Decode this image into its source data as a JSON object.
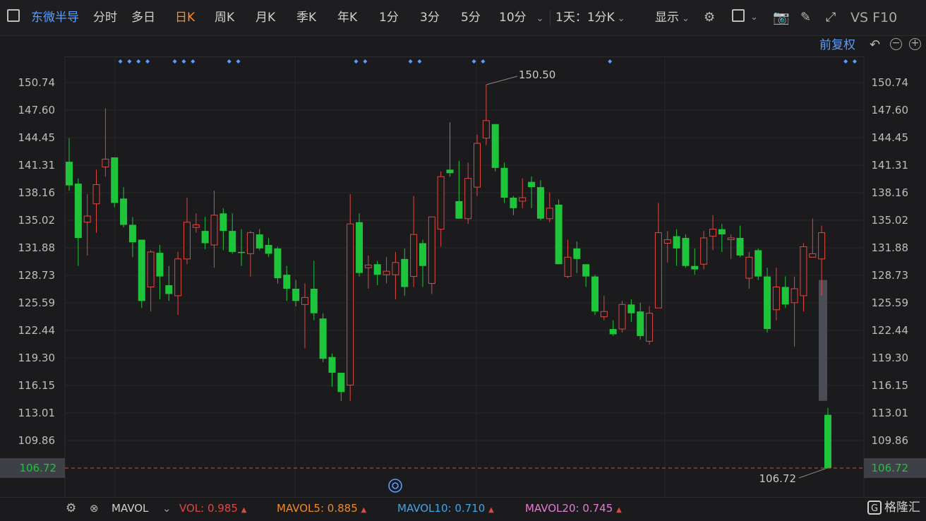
{
  "toolbar": {
    "stock_name": "东微半导",
    "periods": [
      "分时",
      "多日",
      "日K",
      "周K",
      "月K",
      "季K",
      "年K",
      "1分",
      "3分",
      "5分",
      "10分"
    ],
    "active_period": "日K",
    "multi": "1天：1分K",
    "display": "显示",
    "f10": "VS F10"
  },
  "chart_header": {
    "adjust": "前复权"
  },
  "axis": {
    "ticks": [
      "150.74",
      "147.60",
      "144.45",
      "141.31",
      "138.16",
      "135.02",
      "131.88",
      "128.73",
      "125.59",
      "122.44",
      "119.30",
      "116.15",
      "113.01",
      "109.86",
      "106.72"
    ],
    "current": "106.72",
    "high_label": "150.50",
    "low_label": "106.72"
  },
  "indicators": {
    "name": "MAVOL",
    "vol_label": "VOL:",
    "vol_value": "0.985",
    "mavol5_label": "MAVOL5:",
    "mavol5_value": "0.885",
    "mavol10_label": "MAVOL10:",
    "mavol10_value": "0.710",
    "mavol20_label": "MAVOL20:",
    "mavol20_value": "0.745",
    "arrow": "▲"
  },
  "brand": {
    "logo_mark": "G",
    "name": "格隆汇"
  },
  "colors": {
    "up": "#e2473f",
    "down": "#1ec53a",
    "accent": "#5b9cff",
    "active": "#ff8a1f",
    "gap": "#4a4d55"
  },
  "chart_data": {
    "type": "candlestick",
    "ylim": [
      106.72,
      150.74
    ],
    "candles": [
      {
        "o": 141.7,
        "c": 139.0,
        "h": 144.4,
        "l": 138.4
      },
      {
        "o": 139.2,
        "c": 133.0,
        "h": 139.8,
        "l": 129.8
      },
      {
        "o": 134.8,
        "c": 135.5,
        "h": 138.0,
        "l": 131.0
      },
      {
        "o": 136.9,
        "c": 139.1,
        "h": 140.8,
        "l": 133.6
      },
      {
        "o": 141.1,
        "c": 142.0,
        "h": 147.8,
        "l": 140.0
      },
      {
        "o": 142.2,
        "c": 137.0,
        "h": 142.2,
        "l": 136.5
      },
      {
        "o": 137.5,
        "c": 134.5,
        "h": 138.8,
        "l": 134.2
      },
      {
        "o": 134.5,
        "c": 132.5,
        "h": 135.4,
        "l": 130.8
      },
      {
        "o": 132.8,
        "c": 125.8,
        "h": 132.8,
        "l": 125.0
      },
      {
        "o": 127.4,
        "c": 131.4,
        "h": 131.6,
        "l": 124.6
      },
      {
        "o": 131.3,
        "c": 128.6,
        "h": 132.2,
        "l": 126.0
      },
      {
        "o": 127.6,
        "c": 126.6,
        "h": 129.8,
        "l": 125.8
      },
      {
        "o": 126.4,
        "c": 130.6,
        "h": 131.4,
        "l": 124.2
      },
      {
        "o": 130.6,
        "c": 134.8,
        "h": 137.6,
        "l": 130.0
      },
      {
        "o": 134.2,
        "c": 134.5,
        "h": 135.8,
        "l": 133.6
      },
      {
        "o": 133.8,
        "c": 132.4,
        "h": 135.4,
        "l": 131.7
      },
      {
        "o": 132.2,
        "c": 135.6,
        "h": 138.4,
        "l": 129.6
      },
      {
        "o": 135.8,
        "c": 133.8,
        "h": 136.4,
        "l": 131.6
      },
      {
        "o": 133.8,
        "c": 131.4,
        "h": 135.8,
        "l": 131.2
      },
      {
        "o": 131.4,
        "c": 131.3,
        "h": 134.0,
        "l": 129.8
      },
      {
        "o": 131.2,
        "c": 133.6,
        "h": 133.8,
        "l": 128.6
      },
      {
        "o": 133.4,
        "c": 131.8,
        "h": 134.0,
        "l": 131.6
      },
      {
        "o": 132.2,
        "c": 131.2,
        "h": 133.0,
        "l": 130.8
      },
      {
        "o": 131.8,
        "c": 128.4,
        "h": 132.0,
        "l": 127.8
      },
      {
        "o": 128.8,
        "c": 127.2,
        "h": 129.8,
        "l": 125.8
      },
      {
        "o": 127.2,
        "c": 125.8,
        "h": 128.2,
        "l": 125.2
      },
      {
        "o": 125.4,
        "c": 126.2,
        "h": 127.8,
        "l": 120.4
      },
      {
        "o": 127.2,
        "c": 124.4,
        "h": 130.4,
        "l": 123.6
      },
      {
        "o": 123.8,
        "c": 119.2,
        "h": 124.4,
        "l": 118.8
      },
      {
        "o": 119.4,
        "c": 117.6,
        "h": 119.8,
        "l": 116.0
      },
      {
        "o": 117.6,
        "c": 115.4,
        "h": 117.6,
        "l": 114.4
      },
      {
        "o": 116.2,
        "c": 134.6,
        "h": 138.0,
        "l": 114.4
      },
      {
        "o": 134.8,
        "c": 129.0,
        "h": 135.8,
        "l": 128.6
      },
      {
        "o": 129.6,
        "c": 129.9,
        "h": 131.0,
        "l": 127.2
      },
      {
        "o": 130.0,
        "c": 128.8,
        "h": 130.4,
        "l": 127.6
      },
      {
        "o": 128.8,
        "c": 129.2,
        "h": 130.8,
        "l": 127.8
      },
      {
        "o": 128.8,
        "c": 130.2,
        "h": 131.4,
        "l": 126.0
      },
      {
        "o": 130.6,
        "c": 127.4,
        "h": 131.8,
        "l": 126.4
      },
      {
        "o": 128.6,
        "c": 133.4,
        "h": 137.8,
        "l": 127.4
      },
      {
        "o": 132.4,
        "c": 129.8,
        "h": 132.8,
        "l": 127.4
      },
      {
        "o": 127.8,
        "c": 135.4,
        "h": 135.4,
        "l": 126.6
      },
      {
        "o": 134.0,
        "c": 140.0,
        "h": 140.6,
        "l": 132.0
      },
      {
        "o": 140.8,
        "c": 140.4,
        "h": 146.2,
        "l": 140.0
      },
      {
        "o": 137.2,
        "c": 135.2,
        "h": 141.8,
        "l": 135.2
      },
      {
        "o": 135.2,
        "c": 139.8,
        "h": 141.6,
        "l": 134.6
      },
      {
        "o": 138.8,
        "c": 143.8,
        "h": 144.8,
        "l": 137.8
      },
      {
        "o": 144.4,
        "c": 146.4,
        "h": 150.5,
        "l": 143.6
      },
      {
        "o": 146.0,
        "c": 141.0,
        "h": 146.0,
        "l": 140.6
      },
      {
        "o": 141.0,
        "c": 137.6,
        "h": 141.6,
        "l": 137.0
      },
      {
        "o": 137.6,
        "c": 136.4,
        "h": 137.8,
        "l": 135.6
      },
      {
        "o": 137.2,
        "c": 137.6,
        "h": 139.8,
        "l": 136.4
      },
      {
        "o": 139.4,
        "c": 138.8,
        "h": 140.0,
        "l": 136.4
      },
      {
        "o": 138.8,
        "c": 135.2,
        "h": 139.6,
        "l": 135.0
      },
      {
        "o": 135.2,
        "c": 136.4,
        "h": 138.2,
        "l": 134.8
      },
      {
        "o": 136.8,
        "c": 130.0,
        "h": 137.4,
        "l": 130.0
      },
      {
        "o": 128.6,
        "c": 130.8,
        "h": 132.8,
        "l": 128.4
      },
      {
        "o": 131.8,
        "c": 130.6,
        "h": 132.6,
        "l": 129.0
      },
      {
        "o": 130.0,
        "c": 128.6,
        "h": 130.0,
        "l": 127.4
      },
      {
        "o": 128.6,
        "c": 124.6,
        "h": 128.8,
        "l": 124.2
      },
      {
        "o": 124.0,
        "c": 124.6,
        "h": 126.4,
        "l": 123.6
      },
      {
        "o": 122.6,
        "c": 122.0,
        "h": 123.6,
        "l": 121.8
      },
      {
        "o": 122.6,
        "c": 125.4,
        "h": 125.8,
        "l": 122.2
      },
      {
        "o": 125.4,
        "c": 124.4,
        "h": 126.0,
        "l": 123.4
      },
      {
        "o": 124.6,
        "c": 121.8,
        "h": 125.6,
        "l": 121.4
      },
      {
        "o": 121.2,
        "c": 124.4,
        "h": 125.2,
        "l": 120.8
      },
      {
        "o": 125.0,
        "c": 133.6,
        "h": 137.0,
        "l": 125.0
      },
      {
        "o": 132.4,
        "c": 132.8,
        "h": 133.8,
        "l": 130.2
      },
      {
        "o": 133.2,
        "c": 131.8,
        "h": 134.0,
        "l": 129.8
      },
      {
        "o": 133.0,
        "c": 129.8,
        "h": 133.4,
        "l": 129.6
      },
      {
        "o": 129.8,
        "c": 129.4,
        "h": 131.8,
        "l": 128.8
      },
      {
        "o": 130.0,
        "c": 133.0,
        "h": 133.8,
        "l": 129.4
      },
      {
        "o": 133.2,
        "c": 134.0,
        "h": 135.6,
        "l": 131.6
      },
      {
        "o": 134.0,
        "c": 133.4,
        "h": 134.6,
        "l": 131.4
      },
      {
        "o": 132.8,
        "c": 133.0,
        "h": 133.4,
        "l": 130.6
      },
      {
        "o": 133.0,
        "c": 131.0,
        "h": 134.4,
        "l": 130.8
      },
      {
        "o": 128.4,
        "c": 130.8,
        "h": 131.4,
        "l": 127.2
      },
      {
        "o": 131.6,
        "c": 128.6,
        "h": 131.8,
        "l": 128.2
      },
      {
        "o": 128.6,
        "c": 122.6,
        "h": 129.6,
        "l": 122.2
      },
      {
        "o": 124.8,
        "c": 127.4,
        "h": 129.6,
        "l": 123.6
      },
      {
        "o": 127.4,
        "c": 125.4,
        "h": 128.6,
        "l": 125.0
      },
      {
        "o": 125.6,
        "c": 127.2,
        "h": 128.6,
        "l": 120.6
      },
      {
        "o": 126.4,
        "c": 132.0,
        "h": 132.4,
        "l": 124.6
      },
      {
        "o": 130.8,
        "c": 131.2,
        "h": 135.2,
        "l": 130.8
      },
      {
        "o": 130.6,
        "c": 133.6,
        "h": 134.4,
        "l": 126.4
      },
      {
        "o": 112.8,
        "c": 106.72,
        "h": 113.6,
        "l": 106.72
      }
    ],
    "gap_bar": {
      "from": 128.2,
      "to": 114.4
    },
    "markers": [
      3,
      4,
      5,
      6,
      9,
      10,
      11,
      15,
      16,
      29,
      30,
      35,
      36,
      42,
      43,
      57,
      83,
      84
    ]
  }
}
